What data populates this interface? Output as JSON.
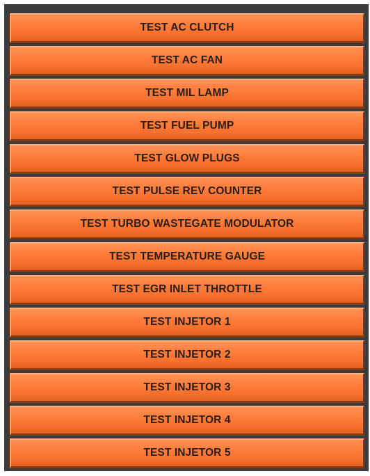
{
  "buttons": [
    {
      "label": "TEST AC CLUTCH"
    },
    {
      "label": "TEST AC FAN"
    },
    {
      "label": "TEST MIL LAMP"
    },
    {
      "label": "TEST FUEL PUMP"
    },
    {
      "label": "TEST GLOW PLUGS"
    },
    {
      "label": "TEST PULSE REV COUNTER"
    },
    {
      "label": "TEST TURBO WASTEGATE MODULATOR"
    },
    {
      "label": "TEST TEMPERATURE GAUGE"
    },
    {
      "label": "TEST EGR INLET THROTTLE"
    },
    {
      "label": "TEST INJETOR 1"
    },
    {
      "label": "TEST INJETOR 2"
    },
    {
      "label": "TEST INJETOR 3"
    },
    {
      "label": "TEST INJETOR 4"
    },
    {
      "label": "TEST INJETOR 5"
    }
  ],
  "colors": {
    "panel_background": "#3b3b3b",
    "button_fill": "#f77a38",
    "button_text": "#2b1d14"
  }
}
